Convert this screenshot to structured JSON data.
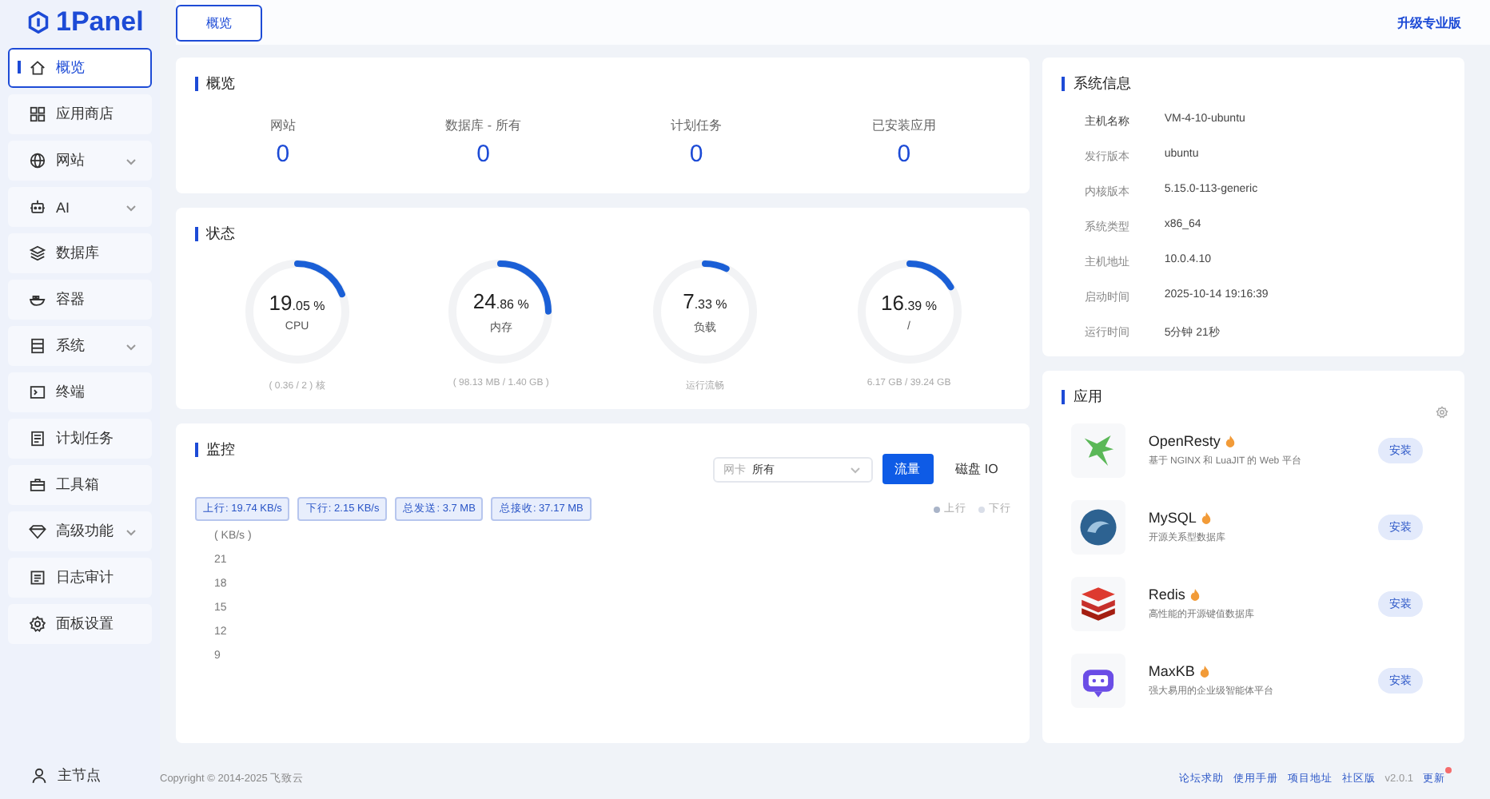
{
  "sidebar": {
    "logo": "1Panel",
    "items": [
      {
        "label": "概览",
        "selected": true,
        "expandable": false
      },
      {
        "label": "应用商店",
        "selected": false,
        "expandable": false
      },
      {
        "label": "网站",
        "selected": false,
        "expandable": true
      },
      {
        "label": "AI",
        "selected": false,
        "expandable": true
      },
      {
        "label": "数据库",
        "selected": false,
        "expandable": false
      },
      {
        "label": "容器",
        "selected": false,
        "expandable": false
      },
      {
        "label": "系统",
        "selected": false,
        "expandable": true
      },
      {
        "label": "终端",
        "selected": false,
        "expandable": false
      },
      {
        "label": "计划任务",
        "selected": false,
        "expandable": false
      },
      {
        "label": "工具箱",
        "selected": false,
        "expandable": false
      },
      {
        "label": "高级功能",
        "selected": false,
        "expandable": true
      },
      {
        "label": "日志审计",
        "selected": false,
        "expandable": false
      },
      {
        "label": "面板设置",
        "selected": false,
        "expandable": false
      }
    ],
    "node": "主节点"
  },
  "header": {
    "tab": "概览",
    "upgrade_link": "升级专业版"
  },
  "overview": {
    "title": "概览",
    "stats": [
      {
        "label": "网站",
        "value": "0"
      },
      {
        "label": "数据库 - 所有",
        "value": "0"
      },
      {
        "label": "计划任务",
        "value": "0"
      },
      {
        "label": "已安装应用",
        "value": "0"
      }
    ]
  },
  "status": {
    "title": "状态",
    "gauges": [
      {
        "integer": "19",
        "fraction": ".05",
        "unit": "%",
        "label": "CPU",
        "level": 0.1905,
        "detail": "( 0.36 / 2 ) 核"
      },
      {
        "integer": "24",
        "fraction": ".86",
        "unit": "%",
        "label": "内存",
        "level": 0.2486,
        "detail": "( 98.13 MB / 1.40 GB )"
      },
      {
        "integer": "7",
        "fraction": ".33",
        "unit": "%",
        "label": "负载",
        "level": 0.0733,
        "detail": "运行流畅"
      },
      {
        "integer": "16",
        "fraction": ".39",
        "unit": "%",
        "label": "/",
        "level": 0.1639,
        "detail": "6.17 GB / 39.24 GB"
      }
    ]
  },
  "monitor": {
    "title": "监控",
    "nic_label": "网卡",
    "nic_value": "所有",
    "modes": [
      {
        "label": "流量",
        "selected": true
      },
      {
        "label": "磁盘 IO",
        "selected": false
      }
    ],
    "tags": [
      "上行: 19.74 KB/s",
      "下行: 2.15 KB/s",
      "总发送: 3.7 MB",
      "总接收: 37.17 MB"
    ],
    "legend": [
      {
        "label": "上行",
        "color": "#a9b4c8"
      },
      {
        "label": "下行",
        "color": "#d9dee8"
      }
    ],
    "unit": "( KB/s )",
    "yticks": [
      "21",
      "18",
      "15",
      "12",
      "9"
    ]
  },
  "sysinfo": {
    "title": "系统信息",
    "rows": [
      {
        "key": "主机名称",
        "value": "VM-4-10-ubuntu"
      },
      {
        "key": "发行版本",
        "value": "ubuntu"
      },
      {
        "key": "内核版本",
        "value": "5.15.0-113-generic"
      },
      {
        "key": "系统类型",
        "value": "x86_64"
      },
      {
        "key": "主机地址",
        "value": "10.0.4.10"
      },
      {
        "key": "启动时间",
        "value": "2025-10-14 19:16:39"
      },
      {
        "key": "运行时间",
        "value": "5分钟 21秒"
      }
    ]
  },
  "apps": {
    "title": "应用",
    "items": [
      {
        "name": "OpenResty",
        "desc": "基于 NGINX 和 LuaJIT 的 Web 平台",
        "button": "安装",
        "hot": true
      },
      {
        "name": "MySQL",
        "desc": "开源关系型数据库",
        "button": "安装",
        "hot": true
      },
      {
        "name": "Redis",
        "desc": "高性能的开源键值数据库",
        "button": "安装",
        "hot": true
      },
      {
        "name": "MaxKB",
        "desc": "强大易用的企业级智能体平台",
        "button": "安装",
        "hot": true
      }
    ]
  },
  "footer": {
    "copyright": "Copyright © 2014-2025 飞致云",
    "links": [
      "论坛求助",
      "使用手册",
      "项目地址",
      "社区版"
    ],
    "version": "v2.0.1",
    "update": "更新",
    "update_badge": true
  }
}
